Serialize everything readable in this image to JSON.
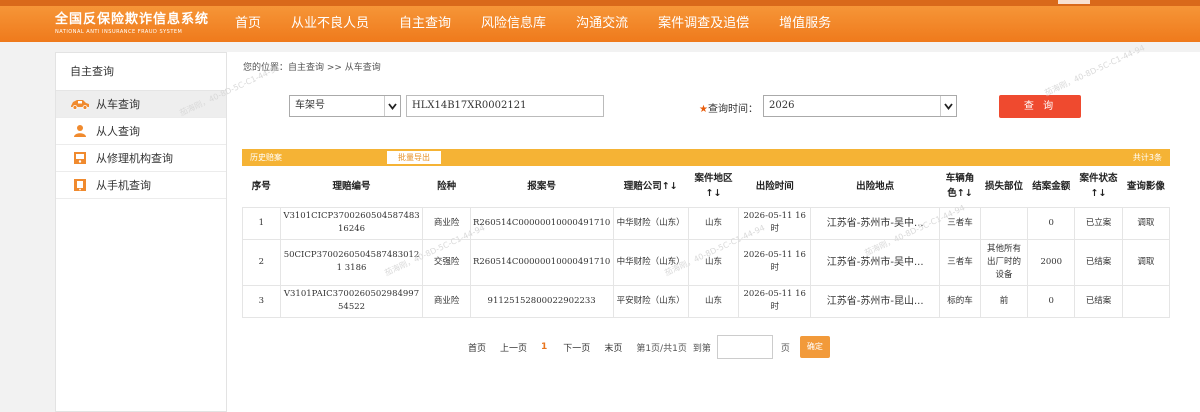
{
  "site": {
    "title_cn": "全国反保险欺诈信息系统",
    "title_en": "NATIONAL ANTI INSURANCE FRAUD SYSTEM"
  },
  "nav": [
    "首页",
    "从业不良人员",
    "自主查询",
    "风险信息库",
    "沟通交流",
    "案件调查及追偿",
    "增值服务"
  ],
  "sidebar": {
    "title": "自主查询",
    "items": [
      {
        "label": "从车查询",
        "icon": "car-icon"
      },
      {
        "label": "从人查询",
        "icon": "person-icon"
      },
      {
        "label": "从修理机构查询",
        "icon": "repair-shop-icon"
      },
      {
        "label": "从手机查询",
        "icon": "phone-icon"
      }
    ]
  },
  "breadcrumb": "您的位置：自主查询 >> 从车查询",
  "search": {
    "field_type": "车架号",
    "vin_value": "HLX14B17XR0002121",
    "time_label": "查询时间：",
    "time_value": "2026",
    "query_button": "查 询"
  },
  "table": {
    "history_label": "历史赔案",
    "export_label": "批量导出",
    "total_label": "共计3条",
    "headers": [
      "序号",
      "理赔编号",
      "险种",
      "报案号",
      "理赔公司↑↓",
      "案件地区↑↓",
      "出险时间",
      "出险地点",
      "车辆角色↑↓",
      "损失部位",
      "结案金额",
      "案件状态↑↓",
      "查询影像"
    ],
    "rows": [
      [
        "1",
        "V3101CICP370026050458748316246",
        "商业险",
        "R260514C00000010000491710",
        "中华财险（山东）",
        "山东",
        "2026-05-11 16时",
        "江苏省-苏州市-吴中...",
        "三者车",
        "",
        "0",
        "已立案",
        "调取"
      ],
      [
        "2",
        "50CICP37002605045874830121 3186",
        "交强险",
        "R260514C00000010000491710",
        "中华财险（山东）",
        "山东",
        "2026-05-11 16时",
        "江苏省-苏州市-吴中...",
        "三者车",
        "其他所有出厂时的设备",
        "2000",
        "已结案",
        "调取"
      ],
      [
        "3",
        "V3101PAIC370026050298499754522",
        "商业险",
        "91125152800022902233",
        "平安财险（山东）",
        "山东",
        "2026-05-11 16时",
        "江苏省-苏州市-昆山...",
        "标的车",
        "前",
        "0",
        "已结案",
        ""
      ]
    ]
  },
  "pager": {
    "first": "首页",
    "prev": "上一页",
    "current": "1",
    "next": "下一页",
    "last": "末页",
    "info": "第1页/共1页",
    "goto": "到第",
    "unit": "页",
    "confirm": "确定"
  },
  "colors": {
    "header": "#ef7a1c",
    "accent": "#f5b335",
    "button": "#ef4a2f",
    "icon_orange": "#f08a2e"
  },
  "watermarks": [
    "茄海刚，40-8D-5C-C1-44-94",
    "茄海刚，40-8D-5C-C1-44-94",
    "茄海刚，40-8D-5C-C1-44-94",
    "茄海刚，40-8D-5C-C1-44-94",
    "茄海刚，40-8D-5C-C1-44-94"
  ]
}
